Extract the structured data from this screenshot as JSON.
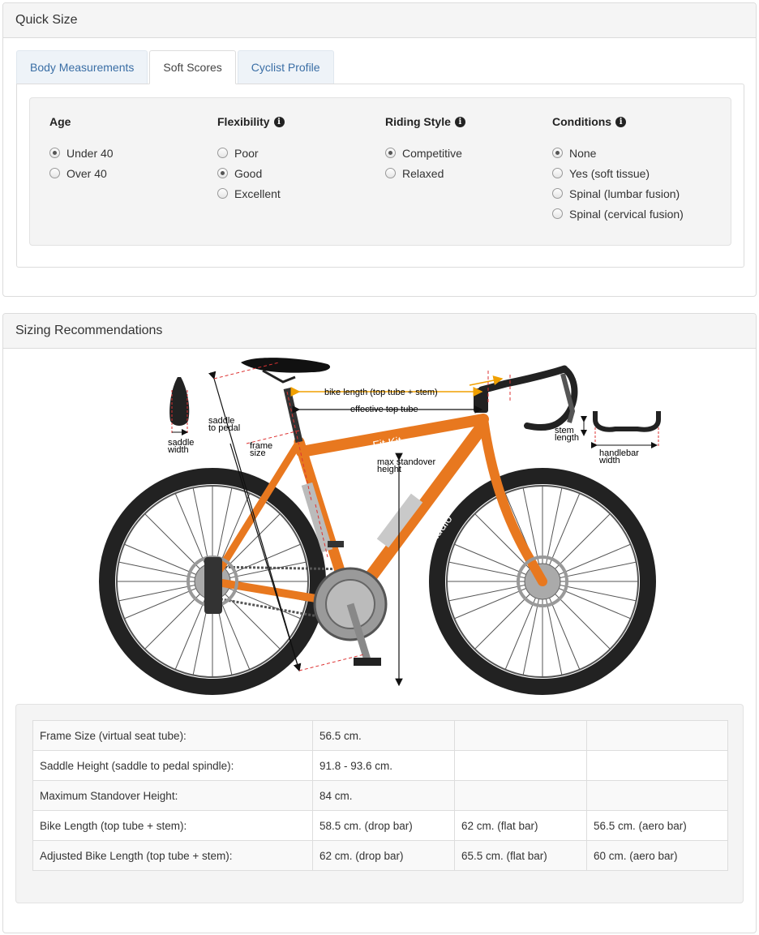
{
  "quick_size": {
    "title": "Quick Size",
    "tabs": [
      {
        "label": "Body Measurements",
        "active": false
      },
      {
        "label": "Soft Scores",
        "active": true
      },
      {
        "label": "Cyclist Profile",
        "active": false
      }
    ],
    "groups": [
      {
        "title": "Age",
        "info": false,
        "options": [
          {
            "label": "Under 40",
            "checked": true
          },
          {
            "label": "Over 40",
            "checked": false
          }
        ]
      },
      {
        "title": "Flexibility",
        "info": true,
        "options": [
          {
            "label": "Poor",
            "checked": false
          },
          {
            "label": "Good",
            "checked": true
          },
          {
            "label": "Excellent",
            "checked": false
          }
        ]
      },
      {
        "title": "Riding Style",
        "info": true,
        "options": [
          {
            "label": "Competitive",
            "checked": true
          },
          {
            "label": "Relaxed",
            "checked": false
          }
        ]
      },
      {
        "title": "Conditions",
        "info": true,
        "options": [
          {
            "label": "None",
            "checked": true
          },
          {
            "label": "Yes (soft tissue)",
            "checked": false
          },
          {
            "label": "Spinal (lumbar fusion)",
            "checked": false
          },
          {
            "label": "Spinal (cervical fusion)",
            "checked": false
          }
        ]
      }
    ]
  },
  "sizing": {
    "title": "Sizing Recommendations",
    "diagram": {
      "saddle_width": [
        "saddle",
        "width"
      ],
      "saddle_to_pedal": [
        "saddle",
        "to pedal"
      ],
      "frame_size": [
        "frame",
        "size"
      ],
      "bike_length": "bike length (top tube + stem)",
      "effective_top_tube": "effective top tube",
      "max_standover": [
        "max standover",
        "height"
      ],
      "stem_length": [
        "stem",
        "length"
      ],
      "handlebar_width": [
        "handlebar",
        "width"
      ],
      "frame_text_1": "Fit Kit",
      "frame_text_2": "Studio",
      "frame_color": "#e8781f"
    },
    "rows": [
      [
        "Frame Size (virtual seat tube):",
        "56.5 cm.",
        "",
        ""
      ],
      [
        "Saddle Height (saddle to pedal spindle):",
        "91.8 - 93.6 cm.",
        "",
        ""
      ],
      [
        "Maximum Standover Height:",
        "84 cm.",
        "",
        ""
      ],
      [
        "Bike Length (top tube + stem):",
        "58.5 cm. (drop bar)",
        "62 cm. (flat bar)",
        "56.5 cm. (aero bar)"
      ],
      [
        "Adjusted Bike Length (top tube + stem):",
        "62 cm. (drop bar)",
        "65.5 cm. (flat bar)",
        "60 cm. (aero bar)"
      ]
    ]
  }
}
